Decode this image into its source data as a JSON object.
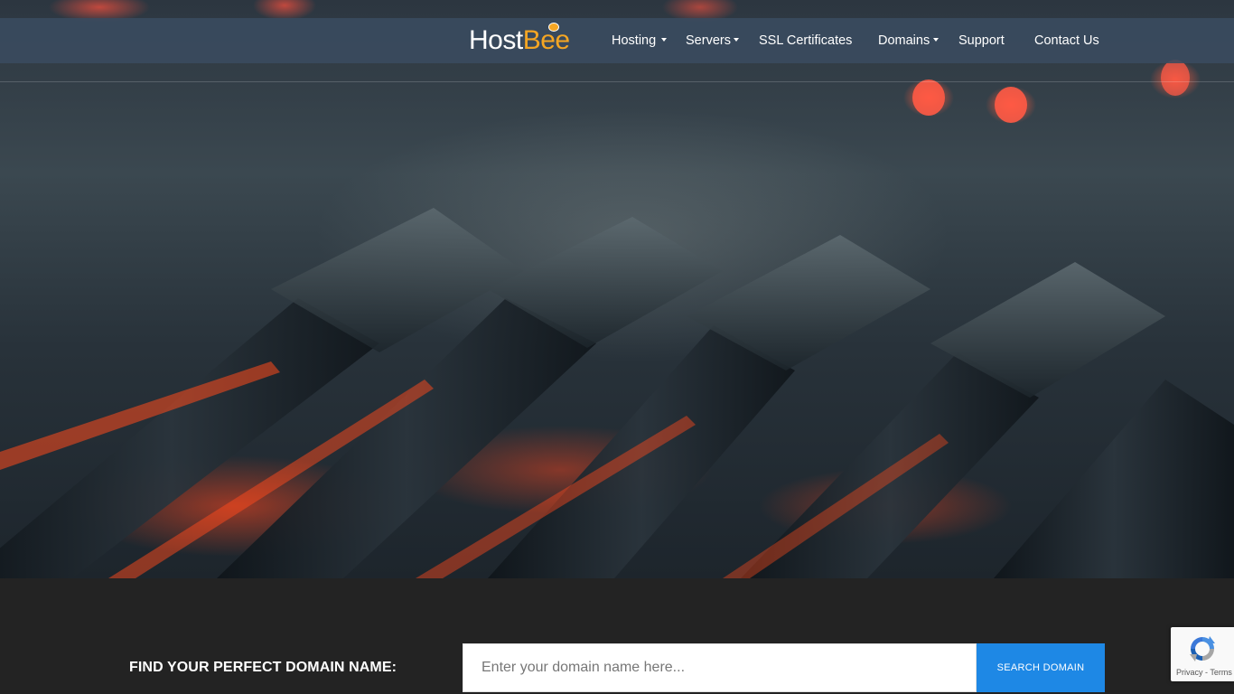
{
  "header": {
    "logo": {
      "host": "Host",
      "bee": "Bee"
    },
    "nav": [
      {
        "label": "Hosting",
        "has_dropdown": true
      },
      {
        "label": "Servers",
        "has_dropdown": true
      },
      {
        "label": "SSL Certificates",
        "has_dropdown": false
      },
      {
        "label": "Domains",
        "has_dropdown": true
      },
      {
        "label": "Support",
        "has_dropdown": false
      },
      {
        "label": "Contact Us",
        "has_dropdown": false
      }
    ]
  },
  "domain_search": {
    "title": "FIND YOUR PERFECT DOMAIN NAME:",
    "placeholder": "Enter your domain name here...",
    "button_label": "SEARCH DOMAIN"
  },
  "recaptcha": {
    "privacy": "Privacy",
    "separator": " - ",
    "terms": "Terms"
  },
  "colors": {
    "navbar": "#3a4b60",
    "logo_accent": "#f5a623",
    "search_button": "#1e88e5",
    "section_bg": "#232323"
  },
  "icons": [
    "hostbee-logo",
    "chevron-down-icon",
    "recaptcha-icon"
  ]
}
